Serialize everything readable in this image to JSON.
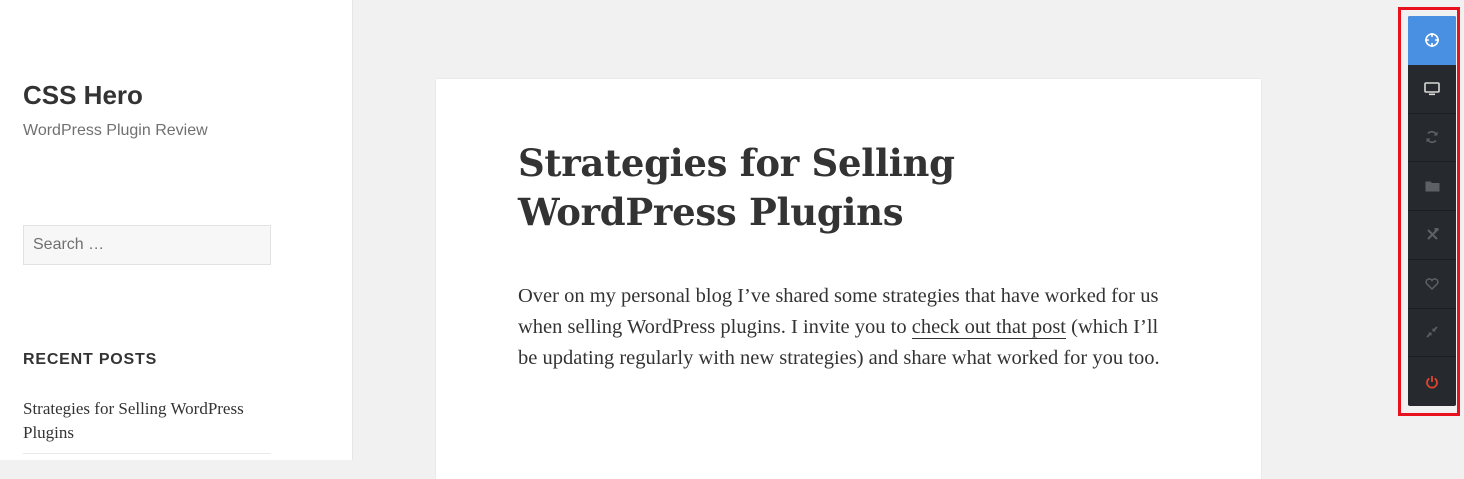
{
  "site": {
    "title": "CSS Hero",
    "description": "WordPress Plugin Review"
  },
  "search": {
    "placeholder": "Search …",
    "value": ""
  },
  "recent_posts": {
    "heading": "RECENT POSTS",
    "items": [
      {
        "label": "Strategies for Selling WordPress Plugins"
      }
    ]
  },
  "article": {
    "title": "Strategies for Selling WordPress Plugins",
    "paragraph": {
      "text_before": "Over on my personal blog I’ve shared some strategies that have worked for us when selling WordPress plugins. I invite you to ",
      "link_text": "check out that post",
      "text_after": " (which I’ll be updating regularly with new strategies) and share what worked for you too."
    }
  },
  "toolbar": {
    "colors": {
      "background": "#262a2e",
      "active": "#4a90e2",
      "icon": "#d9d9d9",
      "icon_dim": "#5d6166",
      "power": "#e0452e",
      "highlight_frame": "#e8111d"
    },
    "buttons": [
      {
        "icon": "crosshair-icon",
        "active": true
      },
      {
        "icon": "monitor-icon",
        "active": false
      },
      {
        "icon": "refresh-icon",
        "active": false
      },
      {
        "icon": "folder-icon",
        "active": false
      },
      {
        "icon": "tools-icon",
        "active": false
      },
      {
        "icon": "heart-icon",
        "active": false
      },
      {
        "icon": "collapse-icon",
        "active": false
      },
      {
        "icon": "power-icon",
        "active": false
      }
    ]
  }
}
